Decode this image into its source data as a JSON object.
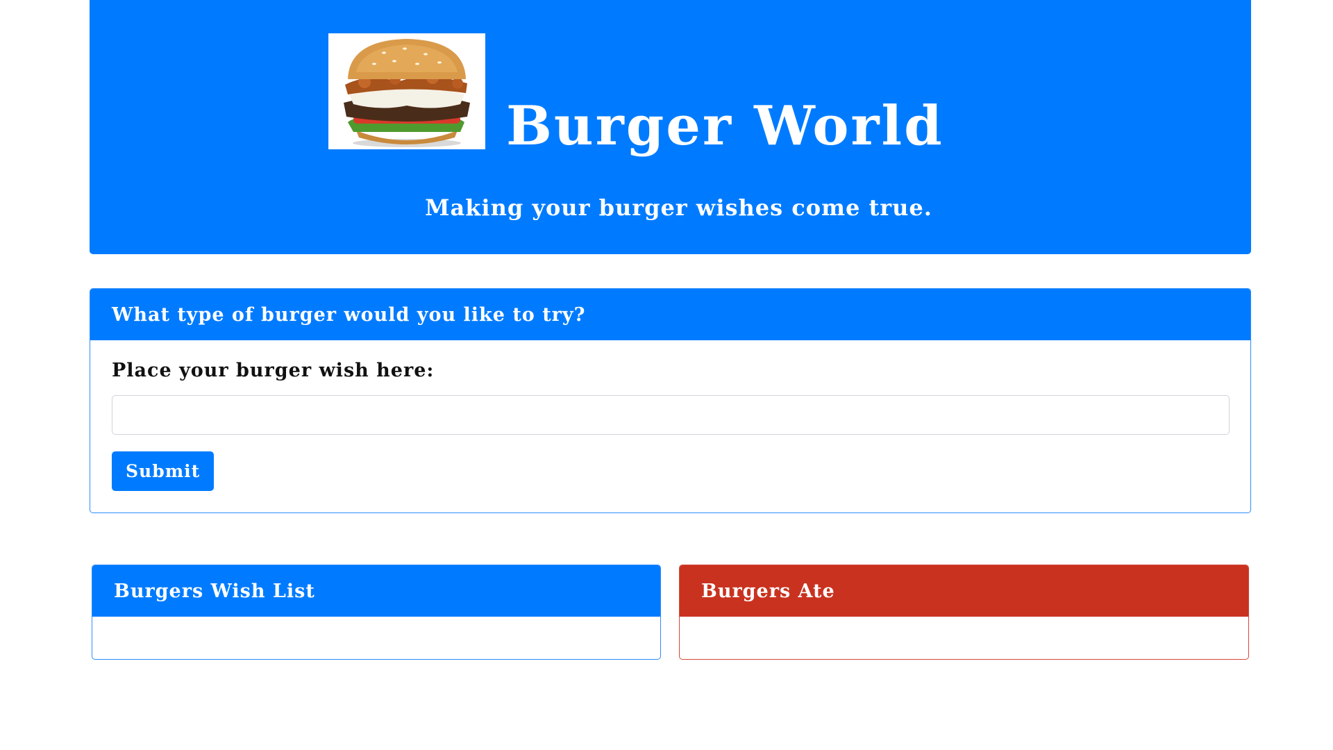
{
  "header": {
    "logo_alt": "burger logo",
    "title": "Burger World",
    "tagline": "Making your burger wishes come true."
  },
  "order_form": {
    "heading": "What type of burger would you like to try?",
    "label": "Place your burger wish here:",
    "input_value": "",
    "input_placeholder": "",
    "submit_label": "Submit"
  },
  "wish_list": {
    "heading": "Burgers Wish List",
    "items": []
  },
  "eaten_list": {
    "heading": "Burgers Ate",
    "items": []
  },
  "colors": {
    "primary": "#007bff",
    "danger": "#c9321f",
    "background": "#ffffff"
  }
}
